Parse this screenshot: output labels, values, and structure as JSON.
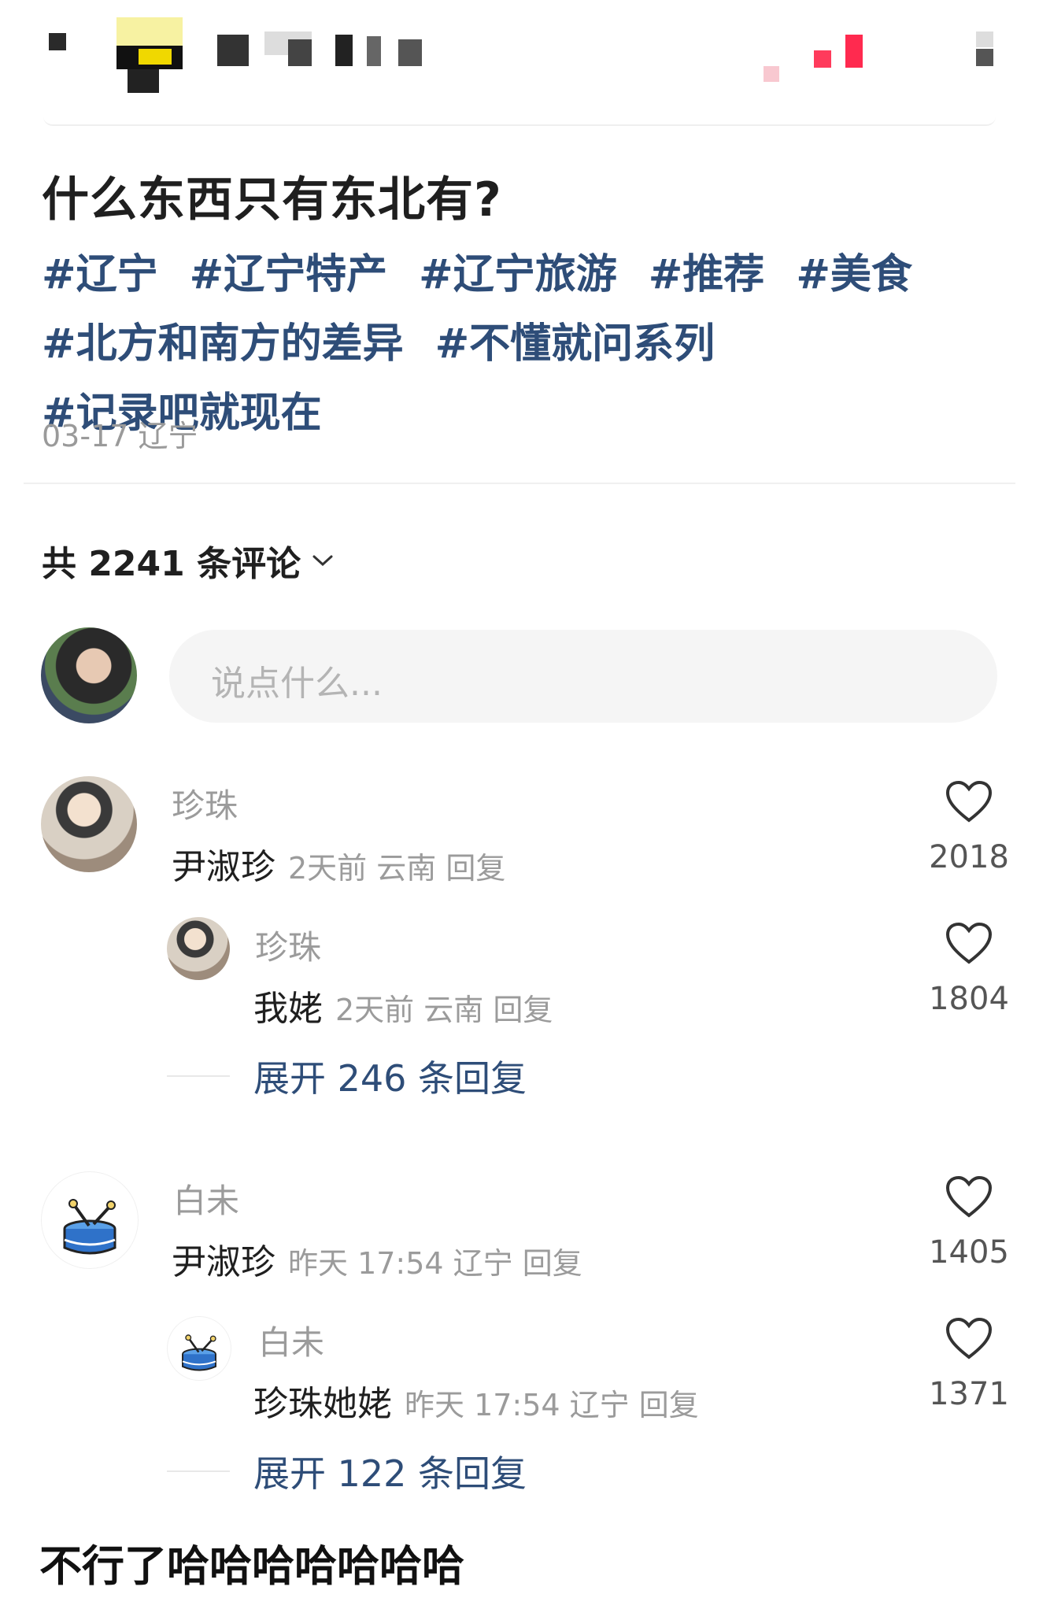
{
  "post": {
    "title": "什么东西只有东北有?",
    "tags": [
      "#辽宁",
      "#辽宁特产",
      "#辽宁旅游",
      "#推荐",
      "#美食",
      "#北方和南方的差异",
      "#不懂就问系列",
      "#记录吧就现在"
    ],
    "date_location": "03-17 辽宁"
  },
  "comments_header": {
    "count_label": "共 2241 条评论"
  },
  "input": {
    "placeholder": "说点什么..."
  },
  "comments": [
    {
      "username": "珍珠",
      "text": "尹淑珍",
      "meta": "2天前 云南 回复",
      "likes": "2018",
      "reply": {
        "username": "珍珠",
        "text": "我姥",
        "meta": "2天前 云南 回复",
        "likes": "1804"
      },
      "expand_label": "展开 246 条回复"
    },
    {
      "username": "白未",
      "text": "尹淑珍",
      "meta": "昨天 17:54 辽宁 回复",
      "likes": "1405",
      "reply": {
        "username": "白未",
        "text": "珍珠她姥",
        "meta": "昨天 17:54 辽宁 回复",
        "likes": "1371"
      },
      "expand_label": "展开 122 条回复"
    }
  ],
  "caption": "不行了哈哈哈哈哈哈哈",
  "icons": {
    "like": "heart-icon",
    "chevron": "chevron-down-icon",
    "drum_avatar": "drum-icon"
  },
  "colors": {
    "link": "#2e4d78",
    "muted": "#9b9b9b",
    "input_bg": "#f5f5f5"
  }
}
